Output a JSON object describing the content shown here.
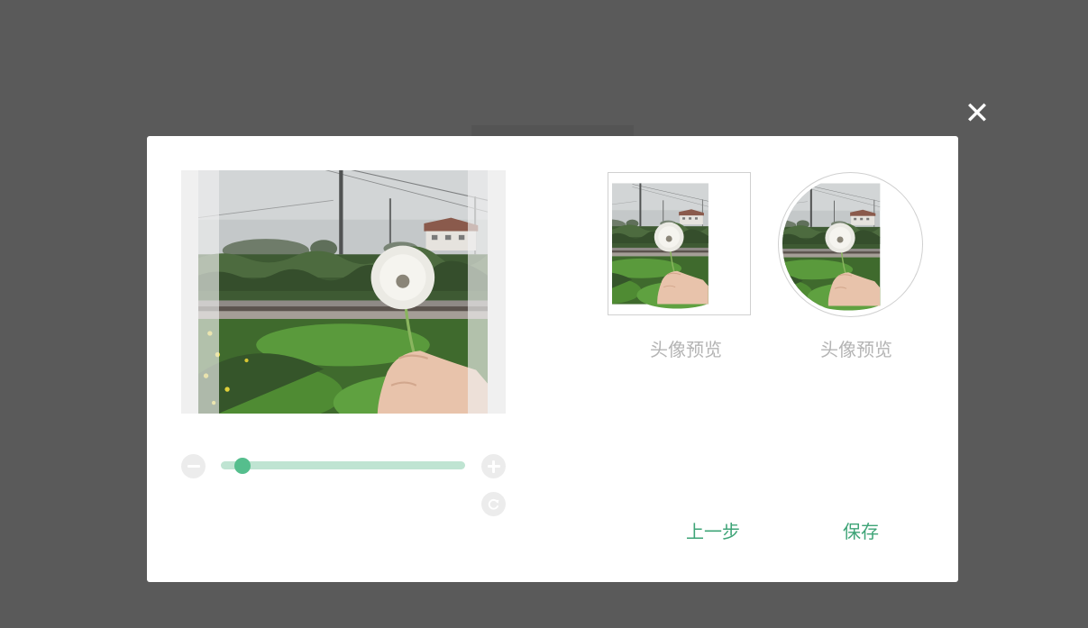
{
  "dialog": {
    "close_icon": "close-icon",
    "preview_square_label": "头像预览",
    "preview_circle_label": "头像预览",
    "prev_button_label": "上一步",
    "save_button_label": "保存"
  },
  "controls": {
    "zoom_out_icon": "minus-circle-icon",
    "zoom_in_icon": "plus-circle-icon",
    "rotate_icon": "rotate-icon",
    "zoom_level": 0.09
  },
  "colors": {
    "overlay": "#5a5a5a",
    "accent": "#3ea477",
    "slider_thumb": "#55be8d",
    "slider_track": "#bfe4d2",
    "label_gray": "#b4b4b4"
  }
}
